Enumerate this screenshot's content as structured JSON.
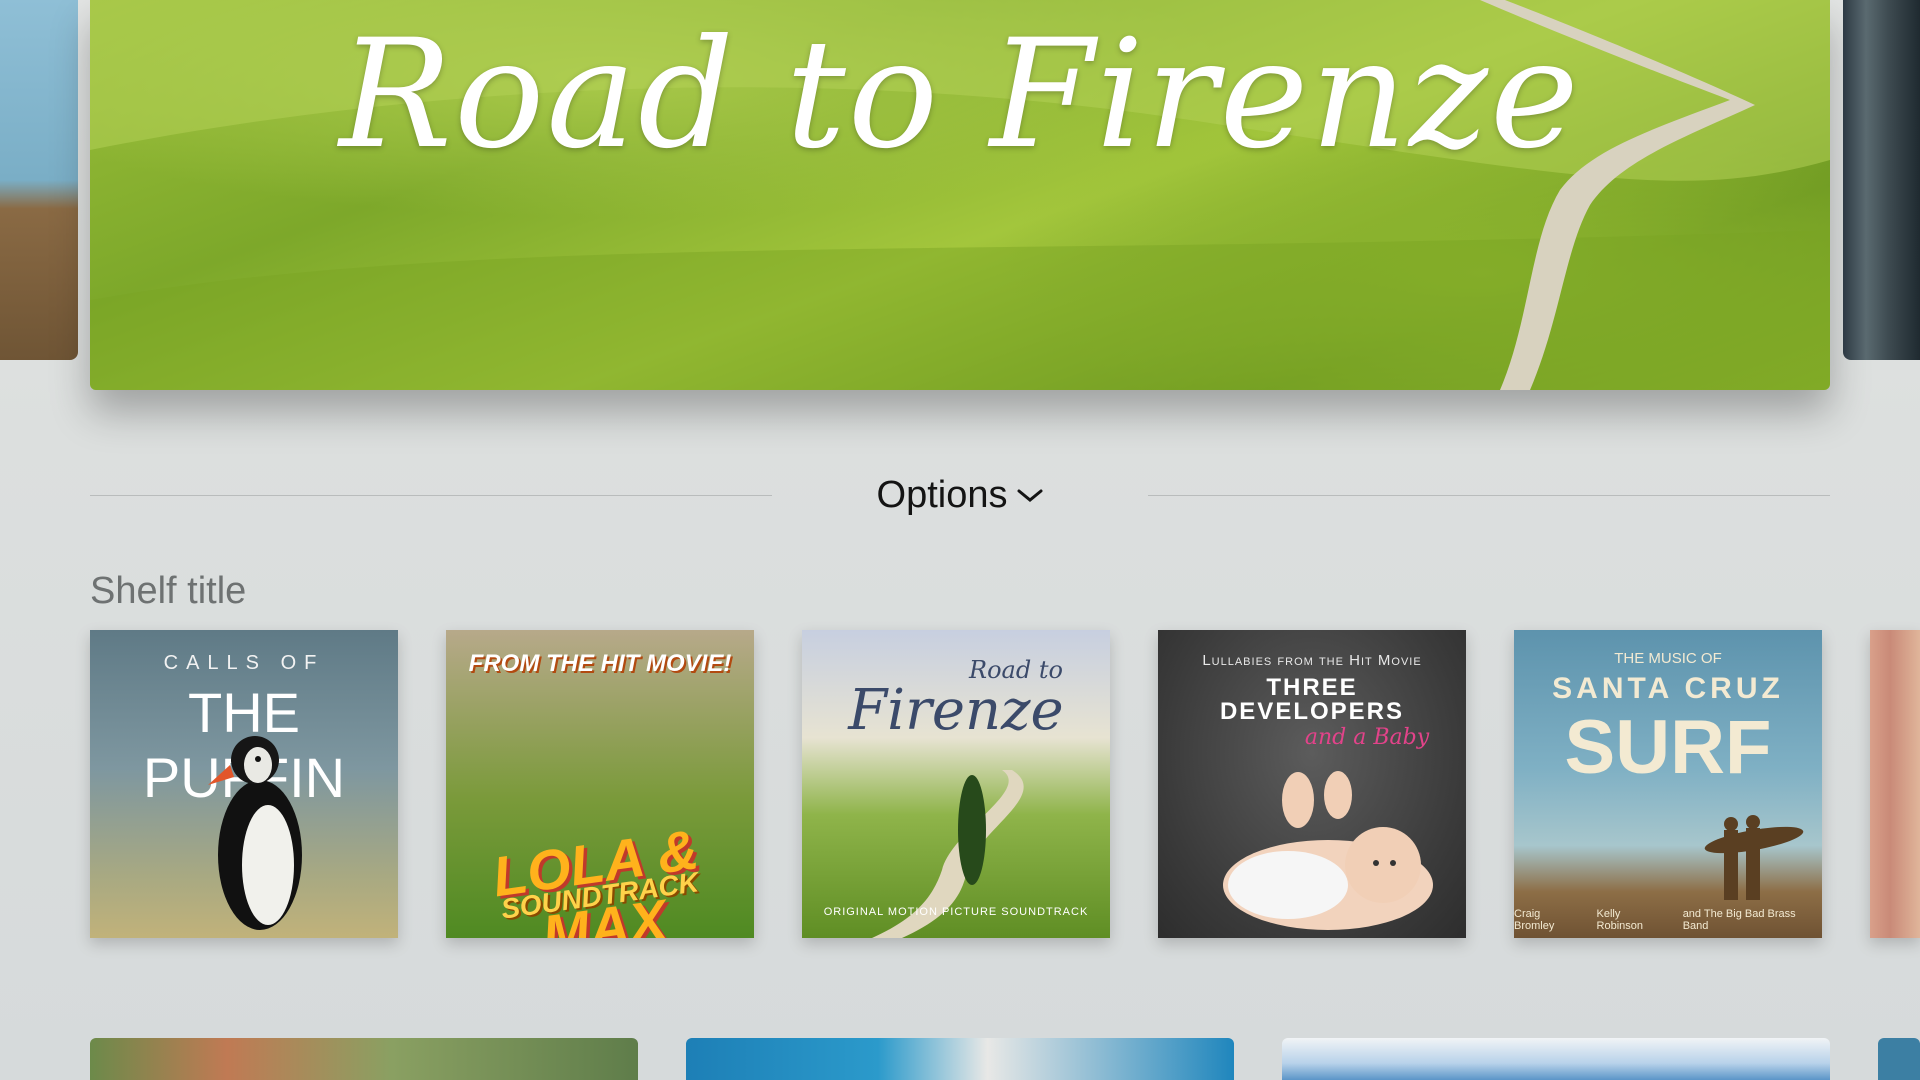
{
  "hero": {
    "title": "Road to Firenze"
  },
  "options": {
    "label": "Options"
  },
  "shelf": {
    "title": "Shelf title",
    "items": [
      {
        "lines": [
          "CALLS OF",
          "THE PUFFIN"
        ]
      },
      {
        "lines": [
          "FROM THE HIT MOVIE!",
          "LOLA & MAX",
          "SOUNDTRACK"
        ]
      },
      {
        "lines": [
          "Road to",
          "Firenze",
          "ORIGINAL MOTION PICTURE SOUNDTRACK"
        ]
      },
      {
        "lines": [
          "Lullabies from the Hit Movie",
          "THREE",
          "DEVELOPERS",
          "and a Baby"
        ]
      },
      {
        "lines": [
          "THE MUSIC OF",
          "SANTA CRUZ",
          "SURF",
          "Craig Bromley",
          "Kelly Robinson",
          "and The Big Bad Brass Band"
        ]
      }
    ]
  }
}
